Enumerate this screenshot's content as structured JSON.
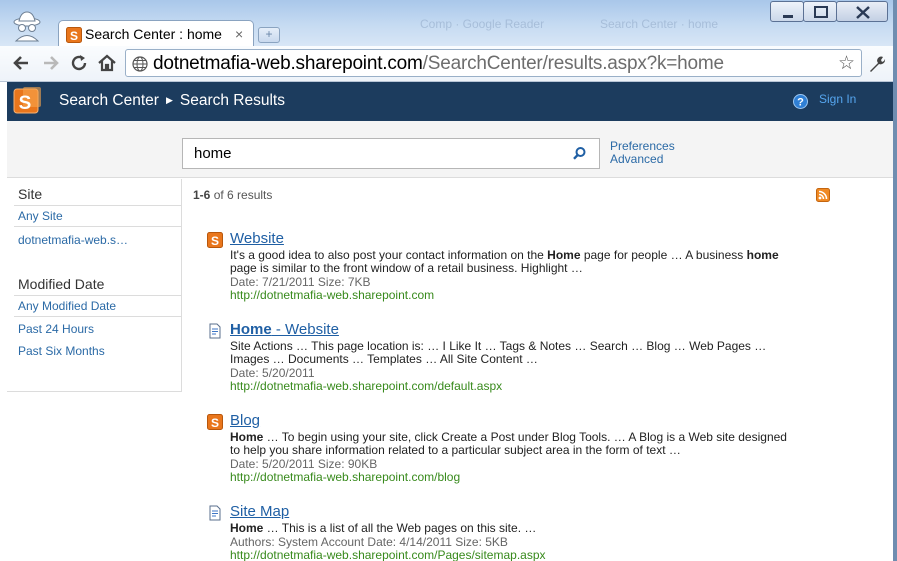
{
  "browser": {
    "tab_title": "Search Center : home",
    "tab_close": "×",
    "new_tab": "+",
    "url_host": "dotnetmafia-web.sharepoint.com",
    "url_path": "/SearchCenter/results.aspx?k=home",
    "background_tabs": [
      "Comp · Google Reader",
      "Search Center · home"
    ]
  },
  "sharepoint": {
    "breadcrumb": [
      "Search Center",
      "Search Results"
    ],
    "sign_in": "Sign In",
    "search_value": "home",
    "preferences_link": "Preferences",
    "advanced_link": "Advanced"
  },
  "refiners": {
    "site_heading": "Site",
    "site_items": [
      "Any Site",
      "dotnetmafia-web.s…"
    ],
    "date_heading": "Modified Date",
    "date_items": [
      "Any Modified Date",
      "Past 24 Hours",
      "Past Six Months"
    ]
  },
  "results_summary": {
    "range": "1-6",
    "of_text": "of 6 results"
  },
  "results": [
    {
      "icon": "sharepoint-site-icon",
      "title": "Website",
      "snippet_html": "It's a good idea to also post your contact information on the <b>Home</b> page for people … A business <b>home</b> page is similar to the front window of a retail business. Highlight …",
      "meta": "Date: 7/21/2011    Size: 7KB",
      "url": "http://dotnetmafia-web.sharepoint.com"
    },
    {
      "icon": "page-icon",
      "title_bold": "Home",
      "title_rest": " - Website",
      "snippet_html": "Site Actions … This page location is: … I Like It … Tags &amp; Notes … Search … Blog … Web Pages … Images … Documents … Templates … All Site Content …",
      "meta": "Date: 5/20/2011",
      "url": "http://dotnetmafia-web.sharepoint.com/default.aspx"
    },
    {
      "icon": "sharepoint-site-icon",
      "title": "Blog",
      "snippet_html": "<b>Home</b> … To begin using your site, click Create a Post under Blog Tools. … A Blog is a Web site designed to help you share information related to a particular subject area in the form of text …",
      "meta": "Date: 5/20/2011    Size: 90KB",
      "url": "http://dotnetmafia-web.sharepoint.com/blog"
    },
    {
      "icon": "page-icon",
      "title": "Site Map",
      "snippet_html": "<b>Home</b> … This is a list of all the Web pages on this site. …",
      "meta": "Authors: System Account    Date: 4/14/2011    Size: 5KB",
      "url": "http://dotnetmafia-web.sharepoint.com/Pages/sitemap.aspx"
    }
  ],
  "colors": {
    "ribbon": "#1c3c5e",
    "link": "#1f5fa4",
    "result_url": "#388a1c",
    "sharepoint_orange": "#e9761c"
  }
}
